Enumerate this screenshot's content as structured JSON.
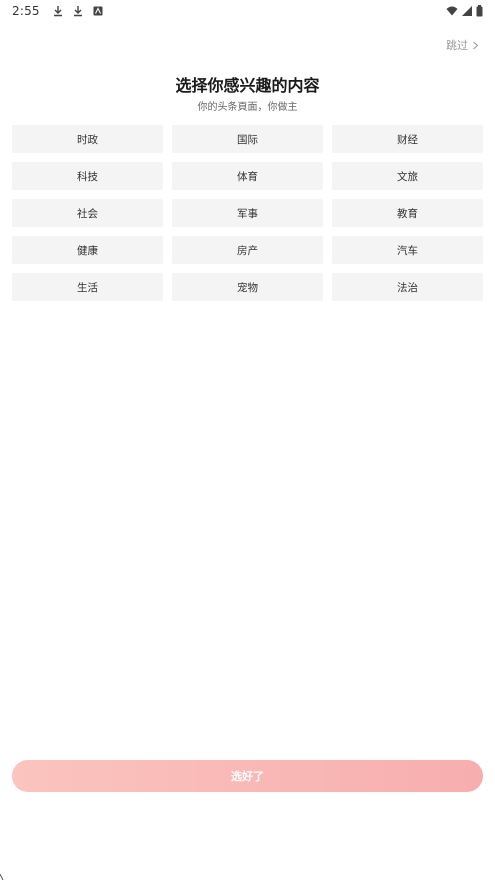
{
  "status_bar": {
    "time": "2:55",
    "icons": [
      "download-icon",
      "download-icon",
      "notification-app-icon",
      "wifi-icon",
      "signal-icon",
      "battery-icon"
    ]
  },
  "header": {
    "skip_label": "跳过",
    "title": "选择你感兴趣的内容",
    "subtitle": "你的头条頁面，你做主"
  },
  "interests": [
    {
      "label": "时政"
    },
    {
      "label": "国际"
    },
    {
      "label": "财经"
    },
    {
      "label": "科技"
    },
    {
      "label": "体育"
    },
    {
      "label": "文旅"
    },
    {
      "label": "社会"
    },
    {
      "label": "军事"
    },
    {
      "label": "教育"
    },
    {
      "label": "健康"
    },
    {
      "label": "房产"
    },
    {
      "label": "汽车"
    },
    {
      "label": "生活"
    },
    {
      "label": "宠物"
    },
    {
      "label": "法治"
    }
  ],
  "footer": {
    "confirm_label": "选好了"
  },
  "colors": {
    "button_gradient_start": "#fbc4bf",
    "button_gradient_end": "#f7aeae",
    "chip_background": "#f4f4f4"
  }
}
